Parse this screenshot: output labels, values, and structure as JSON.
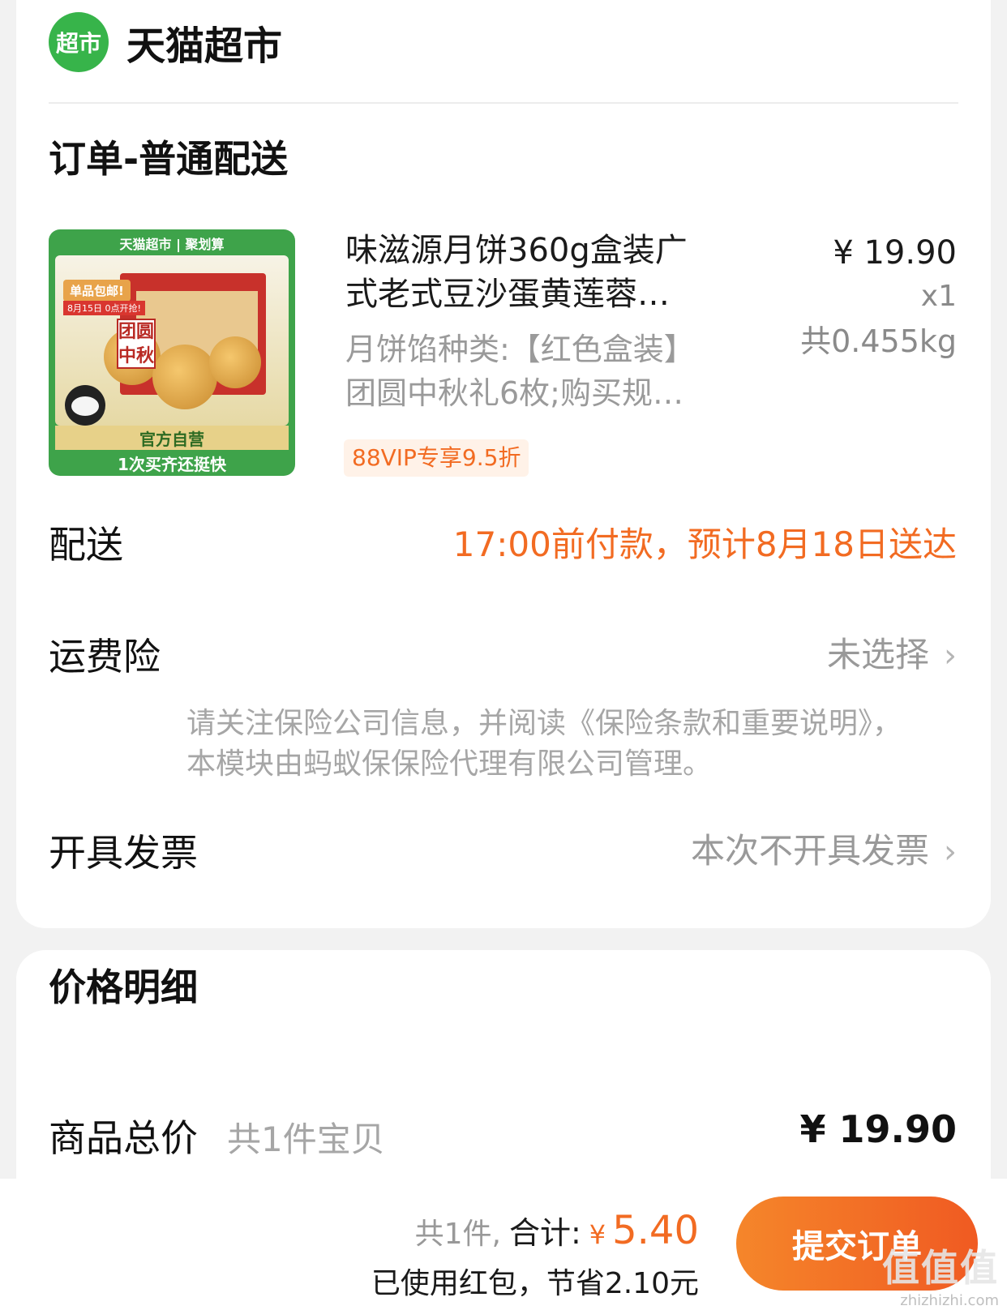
{
  "store": {
    "logo_text": "超市",
    "name": "天猫超市"
  },
  "order": {
    "title": "订单-普通配送"
  },
  "product": {
    "image": {
      "top_banner": "天猫超市 | 聚划算",
      "badge": "单品包邮!",
      "badge_sub": "8月15日 0点开抢!",
      "box_text": "团圆中秋",
      "ziying": "官方自营",
      "bottom": "1次买齐还挺快"
    },
    "title_line1": "味滋源月饼360g盒装广",
    "title_line2": "式老式豆沙蛋黄莲蓉…",
    "spec_line1": "月饼馅种类:【红色盒装】",
    "spec_line2": "团圆中秋礼6枚;购买规…",
    "promo": "88VIP专享9.5折",
    "price": "¥ 19.90",
    "qty": "x1",
    "weight": "共0.455kg"
  },
  "delivery": {
    "label": "配送",
    "value": "17:00前付款，预计8月18日送达"
  },
  "insurance": {
    "label": "运费险",
    "value": "未选择",
    "note": "请关注保险公司信息，并阅读《保险条款和重要说明》，本模块由蚂蚁保保险代理有限公司管理。"
  },
  "invoice": {
    "label": "开具发票",
    "value": "本次不开具发票"
  },
  "price_detail": {
    "title": "价格明细",
    "goods_total_label": "商品总价",
    "goods_total_sub": "共1件宝贝",
    "goods_total_value": "¥ 19.90"
  },
  "footer": {
    "count": "共1件,",
    "total_label": "合计:",
    "yen": "¥",
    "amount": "5.40",
    "saved": "已使用红包，节省2.10元",
    "submit": "提交订单"
  },
  "watermark": {
    "main": "值值值",
    "sub": "zhizhizhi.com"
  },
  "colors": {
    "accent": "#f26b22",
    "brand_green": "#37b44a"
  }
}
